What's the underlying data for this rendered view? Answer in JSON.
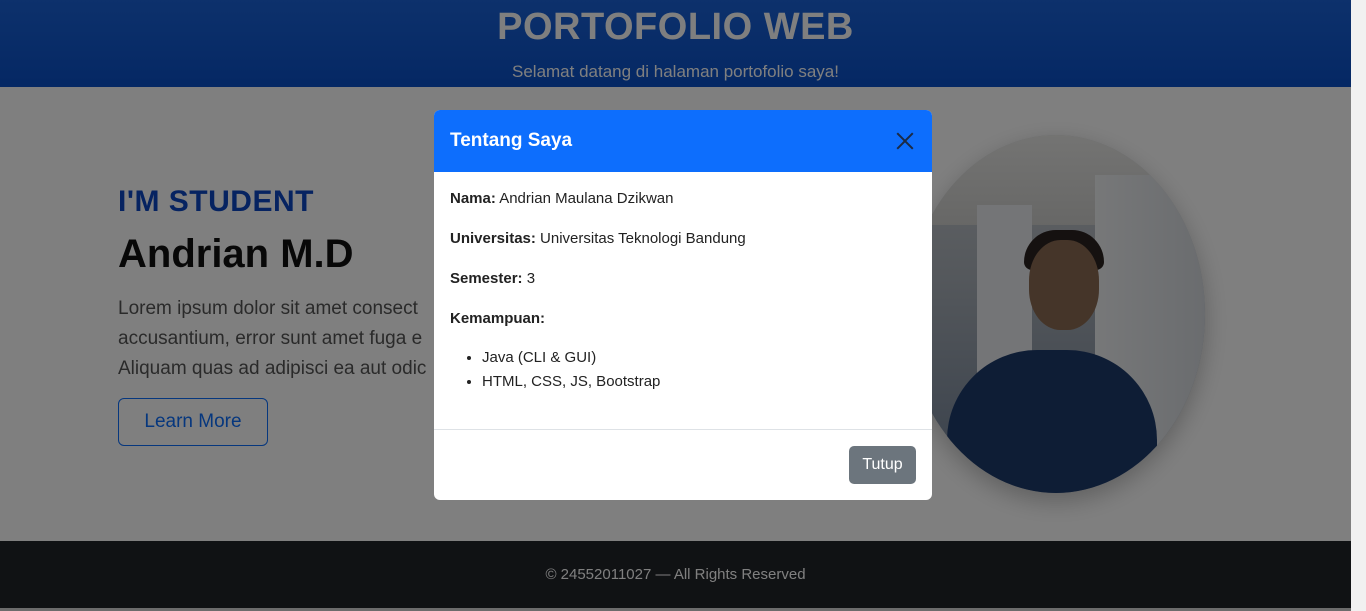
{
  "header": {
    "title": "PORTOFOLIO WEB",
    "subtitle": "Selamat datang di halaman portofolio saya!"
  },
  "hero": {
    "tag": "I'M STUDENT",
    "name": "Andrian M.D",
    "lines": [
      "Lorem ipsum dolor sit amet consect",
      "accusantium, error sunt amet fuga e",
      "Aliquam quas ad adipisci ea aut odic"
    ],
    "button_label": "Learn More"
  },
  "footer": {
    "text": "© 24552011027 — All Rights Reserved"
  },
  "modal": {
    "title": "Tentang Saya",
    "fields": [
      {
        "label": "Nama:",
        "value": "Andrian Maulana Dzikwan"
      },
      {
        "label": "Universitas:",
        "value": "Universitas Teknologi Bandung"
      },
      {
        "label": "Semester:",
        "value": "3"
      },
      {
        "label": "Kemampuan:",
        "value": ""
      }
    ],
    "skills": [
      "Java (CLI & GUI)",
      "HTML, CSS, JS, Bootstrap"
    ],
    "close_label": "Tutup"
  },
  "colors": {
    "primary": "#0d6efd",
    "header_bg": "#0a50c8",
    "footer_bg": "#212529",
    "secondary_button": "#6c757d"
  }
}
